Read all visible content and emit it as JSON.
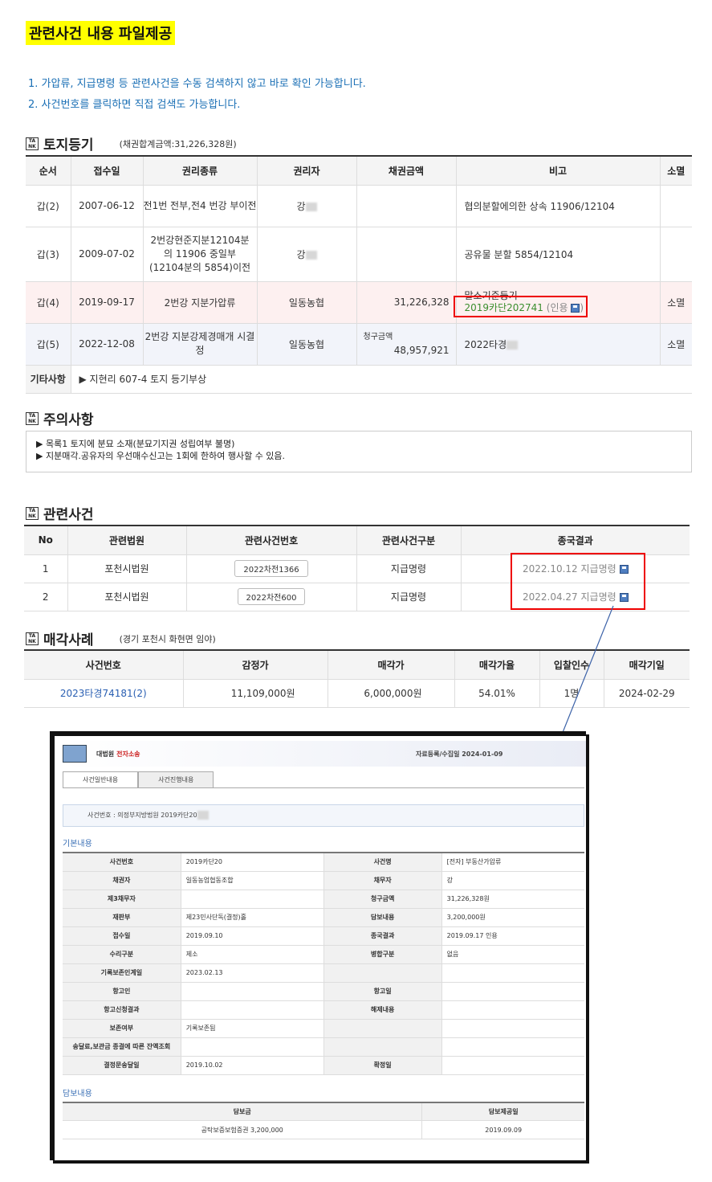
{
  "title": "관련사건 내용 파일제공",
  "notes": [
    "1.  가압류, 지급명령 등 관련사건을 수동 검색하지 않고 바로 확인 가능합니다.",
    "2.  사건번호를 클릭하면 직접 검색도 가능합니다."
  ],
  "land": {
    "heading": "토지등기",
    "sub": "(채권합계금액:31,226,328원)",
    "headers": [
      "순서",
      "접수일",
      "권리종류",
      "권리자",
      "채권금액",
      "비고",
      "소멸"
    ],
    "rows": [
      {
        "no": "갑(2)",
        "date": "2007-06-12",
        "kind": "전1번 전부,전4 번강 부이전",
        "holder": "강",
        "amount": "",
        "note": "협의분할에의한 상속 11906/12104",
        "ext": ""
      },
      {
        "no": "갑(3)",
        "date": "2009-07-02",
        "kind": "2번강현준지분12104분의 11906 중일부(12104분의 5854)이전",
        "holder": "강",
        "amount": "",
        "note": "공유물 분할 5854/12104",
        "ext": ""
      },
      {
        "no": "갑(4)",
        "date": "2019-09-17",
        "kind": "2번강 지분가압류",
        "holder": "일동농협",
        "amount": "31,226,328",
        "note_top": "말소기준등기",
        "note_link": "2019카단202741",
        "note_tail": "(인용",
        "ext": "소멸"
      },
      {
        "no": "갑(5)",
        "date": "2022-12-08",
        "kind": "2번강 지분강제경매개 시결정",
        "holder": "일동농협",
        "amount_label": "청구금액",
        "amount": "48,957,921",
        "note": "2022타경",
        "ext": "소멸"
      }
    ],
    "etc_label": "기타사항",
    "etc_value": "▶ 지현리 607-4 토지 등기부상"
  },
  "caution": {
    "heading": "주의사항",
    "lines": [
      "▶ 목록1 토지에 분묘 소재(분묘기지권 성립여부 불명)",
      "▶ 지분매각.공유자의 우선매수신고는 1회에 한하여 행사할 수 있음."
    ]
  },
  "related": {
    "heading": "관련사건",
    "headers": [
      "No",
      "관련법원",
      "관련사건번호",
      "관련사건구분",
      "종국결과"
    ],
    "rows": [
      {
        "no": "1",
        "court": "포천시법원",
        "case": "2022차전1366",
        "type": "지급명령",
        "result": "2022.10.12 지급명령"
      },
      {
        "no": "2",
        "court": "포천시법원",
        "case": "2022차전600",
        "type": "지급명령",
        "result": "2022.04.27 지급명령"
      }
    ]
  },
  "sales": {
    "heading": "매각사례",
    "sub": "(경기 포천시 화현면 임야)",
    "headers": [
      "사건번호",
      "감정가",
      "매각가",
      "매각가율",
      "입찰인수",
      "매각기일"
    ],
    "row": {
      "case": "2023타경74181(2)",
      "appraisal": "11,109,000원",
      "price": "6,000,000원",
      "rate": "54.01%",
      "bidders": "1명",
      "date": "2024-02-29"
    }
  },
  "court_shot": {
    "brand": "대법원",
    "brand_red": "전자소송",
    "reg": "자료등록/수집일 2024-01-09",
    "tabs": [
      "사건일반내용",
      "사건진행내용"
    ],
    "case_line": "사건번호 : 의정부지방법원 2019카단20",
    "basic_title": "기본내용",
    "rows": [
      [
        "사건번호",
        "2019카단20",
        "사건명",
        "[전자] 부동산가압류"
      ],
      [
        "채권자",
        "일동농업협동조합",
        "채무자",
        "강"
      ],
      [
        "제3채무자",
        "",
        "청구금액",
        "31,226,328원"
      ],
      [
        "재판부",
        "제23민사단독(결정)홀",
        "담보내용",
        "3,200,000원"
      ],
      [
        "접수일",
        "2019.09.10",
        "종국결과",
        "2019.09.17 인용"
      ],
      [
        "수리구분",
        "제소",
        "병합구분",
        "없음"
      ],
      [
        "기록보존인계일",
        "2023.02.13",
        "",
        ""
      ],
      [
        "항고인",
        "",
        "항고일",
        ""
      ],
      [
        "항고신청결과",
        "",
        "해제내용",
        ""
      ],
      [
        "보존여부",
        "기록보존됨",
        "",
        ""
      ],
      [
        "송달료,보관금 종결에 따른 잔액조회",
        "",
        "",
        ""
      ],
      [
        "결정문송달일",
        "2019.10.02",
        "확정일",
        ""
      ]
    ],
    "security_title": "담보내용",
    "security_headers": [
      "담보금",
      "담보제공일"
    ],
    "security_row": [
      "공탁보증보험증권 3,200,000",
      "2019.09.09"
    ]
  },
  "colors": {
    "highlight": "#ffff00",
    "accent_blue": "#1a6fb5",
    "red_box": "#e00000",
    "link_green": "#3a8e2e"
  }
}
